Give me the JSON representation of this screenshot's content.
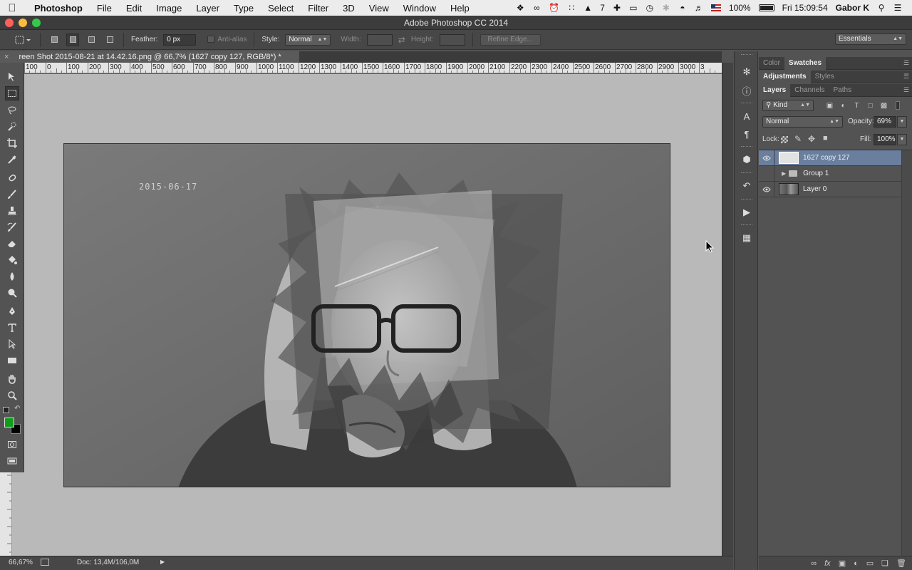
{
  "menubar": {
    "app_name": "Photoshop",
    "menus": [
      "File",
      "Edit",
      "Image",
      "Layer",
      "Type",
      "Select",
      "Filter",
      "3D",
      "View",
      "Window",
      "Help"
    ],
    "notification_count": "7",
    "battery": "100%",
    "clock": "Fri 15:09:54",
    "user": "Gabor K"
  },
  "window": {
    "title": "Adobe Photoshop CC 2014",
    "light_colors": [
      "#fc605c",
      "#fdbc40",
      "#34c84a"
    ]
  },
  "options": {
    "feather_label": "Feather:",
    "feather_value": "0 px",
    "antialias_label": "Anti-alias",
    "style_label": "Style:",
    "style_value": "Normal",
    "width_label": "Width:",
    "height_label": "Height:",
    "refine_edge": "Refine Edge...",
    "workspace": "Essentials"
  },
  "document": {
    "tab_title": "reen Shot 2015-08-21 at 14.42.16.png @ 66,7% (1627 copy 127, RGB/8*) *",
    "date_stamp": "2015-06-17",
    "zoom": "66,67%",
    "doc_size": "Doc: 13,4M/106,0M"
  },
  "rulers": {
    "h_labels": [
      "100",
      "0",
      "100",
      "200",
      "300",
      "400",
      "500",
      "600",
      "700",
      "800",
      "900",
      "1000",
      "1100",
      "1200",
      "1300",
      "1400",
      "1500",
      "1600",
      "1700",
      "1800",
      "1900",
      "2000",
      "2100",
      "2200",
      "2300",
      "2400",
      "2500",
      "2600",
      "2700",
      "2800",
      "2900",
      "3000",
      "3"
    ]
  },
  "tools": {
    "foreground_color": "#0f9d1a",
    "background_color": "#000000"
  },
  "panels": {
    "color_tabs": [
      "Color",
      "Swatches"
    ],
    "adjust_tabs": [
      "Adjustments",
      "Styles"
    ],
    "layers_tabs": [
      "Layers",
      "Channels",
      "Paths"
    ],
    "kind_filter": "Kind",
    "blend_mode": "Normal",
    "opacity_label": "Opacity:",
    "opacity_value": "69%",
    "lock_label": "Lock:",
    "fill_label": "Fill:",
    "fill_value": "100%",
    "layers": [
      {
        "name": "1627 copy 127",
        "selected": true,
        "visible": true
      },
      {
        "name": "Group 1",
        "selected": false,
        "visible": false
      },
      {
        "name": "Layer 0",
        "selected": false,
        "visible": true
      }
    ]
  }
}
